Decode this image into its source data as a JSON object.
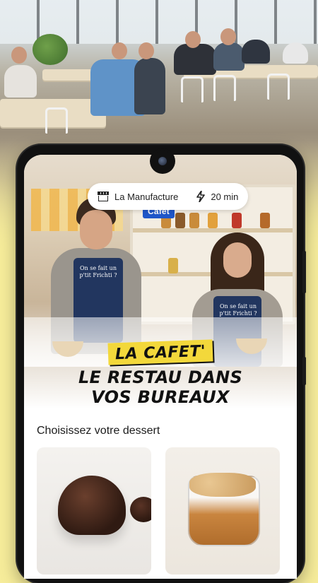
{
  "header_photo": {
    "alt": "cafeteria"
  },
  "app": {
    "location": {
      "name": "La Manufacture",
      "eta": "20 min",
      "icon": "store-icon",
      "eta_icon": "lightning-icon"
    },
    "hero": {
      "sign_label": "Cafet",
      "apron_text": "On se fait un p'tit Frichti ?"
    },
    "headline": {
      "tag": "LA CAFET'",
      "line1": "LE RESTAU DANS",
      "line2": "VOS BUREAUX"
    },
    "section_title": "Choisissez votre dessert",
    "desserts": [
      {
        "name": "chocolate-lava-cake"
      },
      {
        "name": "caramel-crumble-cup"
      }
    ]
  },
  "colors": {
    "background": "#f6ec9a",
    "tag_yellow": "#f3d83b",
    "cafet_blue": "#1f56c9"
  }
}
